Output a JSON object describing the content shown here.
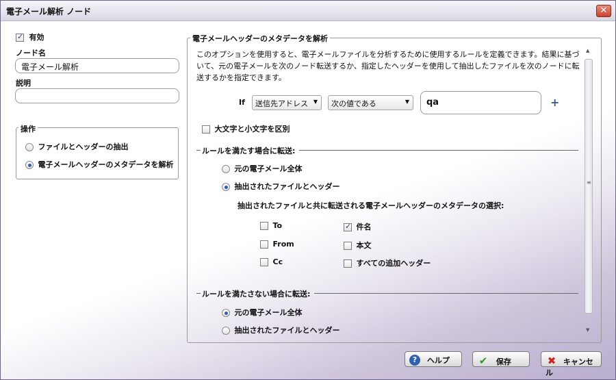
{
  "window": {
    "title": "電子メール解析 ノード",
    "close_label": "✕"
  },
  "left": {
    "enabled_label": "有効",
    "enabled_checked": true,
    "node_name_label": "ノード名",
    "node_name_value": "電子メール解析",
    "description_label": "説明",
    "description_value": "",
    "operation": {
      "title": "操作",
      "option1": "ファイルとヘッダーの抽出",
      "option2": "電子メールヘッダーのメタデータを解析",
      "selected": 2
    }
  },
  "right": {
    "group_title": "電子メールヘッダーのメタデータを解析",
    "description": "このオプションを使用すると、電子メールファイルを分析するために使用するルールを定義できます。結果に基づいて、元の電子メールを次のノード転送するか、指定したヘッダーを使用して抽出したファイルを次のノードに転送するかを指定できます。",
    "if_label": "If",
    "field_combo": "送信先アドレス",
    "operator_combo": "次の値である",
    "value": "qa",
    "add_symbol": "+",
    "case_sensitive_label": "大文字と小文字を区別",
    "case_sensitive_checked": false,
    "match_section": {
      "title": "ルールを満たす場合に転送:",
      "option1": "元の電子メール全体",
      "option2": "抽出されたファイルとヘッダー",
      "selected": 2,
      "metadata_label": "抽出されたファイルと共に転送される電子メールヘッダーのメタデータの選択:",
      "checks": {
        "to": {
          "label": "To",
          "checked": false
        },
        "subject": {
          "label": "件名",
          "checked": true
        },
        "from": {
          "label": "From",
          "checked": false
        },
        "body": {
          "label": "本文",
          "checked": false
        },
        "cc": {
          "label": "Cc",
          "checked": false
        },
        "all_headers": {
          "label": "すべての追加ヘッダー",
          "checked": false
        }
      }
    },
    "nomatch_section": {
      "title": "ルールを満たさない場合に転送:",
      "option1": "元の電子メール全体",
      "option2": "抽出されたファイルとヘッダー",
      "selected": 1
    }
  },
  "buttons": {
    "help": "ヘルプ",
    "save": "保存",
    "cancel": "キャンセル"
  }
}
